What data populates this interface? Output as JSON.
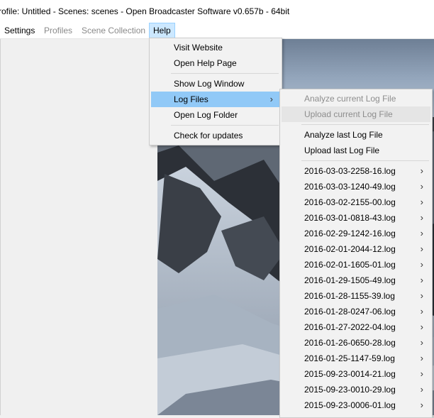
{
  "window": {
    "title": "rofile: Untitled - Scenes: scenes - Open Broadcaster Software v0.657b - 64bit"
  },
  "menubar": {
    "items": [
      {
        "label": "Settings",
        "state": "normal"
      },
      {
        "label": "Profiles",
        "state": "dim"
      },
      {
        "label": "Scene Collection",
        "state": "dim"
      },
      {
        "label": "Help",
        "state": "active"
      }
    ]
  },
  "help_menu": {
    "visit_website": "Visit Website",
    "open_help_page": "Open Help Page",
    "show_log_window": "Show Log Window",
    "log_files": "Log Files",
    "open_log_folder": "Open Log Folder",
    "check_for_updates": "Check for updates"
  },
  "log_files_menu": {
    "analyze_current": "Analyze current Log File",
    "upload_current": "Upload current Log File",
    "analyze_last": "Analyze last Log File",
    "upload_last": "Upload last Log File",
    "logs": [
      "2016-03-03-2258-16.log",
      "2016-03-03-1240-49.log",
      "2016-03-02-2155-00.log",
      "2016-03-01-0818-43.log",
      "2016-02-29-1242-16.log",
      "2016-02-01-2044-12.log",
      "2016-02-01-1605-01.log",
      "2016-01-29-1505-49.log",
      "2016-01-28-1155-39.log",
      "2016-01-28-0247-06.log",
      "2016-01-27-2022-04.log",
      "2016-01-26-0650-28.log",
      "2016-01-25-1147-59.log",
      "2015-09-23-0014-21.log",
      "2015-09-23-0010-29.log",
      "2015-09-23-0006-01.log"
    ]
  },
  "icons": {
    "submenu_arrow": "chevron-right-icon"
  }
}
